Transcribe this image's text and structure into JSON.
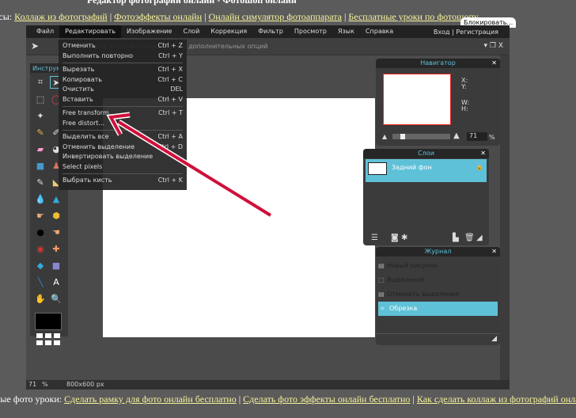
{
  "page": {
    "title": "Редактор фотографий онлайн - Фотошоп онлайн",
    "top_prefix": "исы: ",
    "top_links": [
      "Коллаж из фотографий",
      "Фотоэффекты онлайн",
      "Онлайн симулятор фотоаппарата",
      "Бесплатные уроки по фотошопу"
    ],
    "block_tab": "Блокировать...",
    "bottom_prefix": "ные фото уроки: ",
    "bottom_links": [
      "Сделать рамку для фото онлайн бесплатно",
      "Сделать фото эффекты онлайн бесплатно",
      "Как сделать коллаж из фотографий онлайн"
    ],
    "separator": " | "
  },
  "menu": {
    "items": [
      "Файл",
      "Редактировать",
      "Изображение",
      "Слой",
      "Коррекция",
      "Фильтр",
      "Просмотр",
      "Язык",
      "Справка"
    ],
    "login": "Вход",
    "sep": "|",
    "register": "Регистрация"
  },
  "options": {
    "hint": "Для этого инструмента нет дополнительных опций"
  },
  "tools": {
    "header": "Инструменты"
  },
  "edit_menu": [
    {
      "label": "Отменить",
      "shortcut": "Ctrl + Z"
    },
    {
      "label": "Выполнить повторно",
      "shortcut": "Ctrl + Y"
    },
    {
      "sep": true
    },
    {
      "label": "Вырезать",
      "shortcut": "Ctrl + X"
    },
    {
      "label": "Копировать",
      "shortcut": "Ctrl + C"
    },
    {
      "label": "Очистить",
      "shortcut": "DEL"
    },
    {
      "label": "Вставить",
      "shortcut": "Ctrl + V"
    },
    {
      "sep": true
    },
    {
      "label": "Free transform...",
      "shortcut": "Ctrl + T"
    },
    {
      "label": "Free distort...",
      "shortcut": ""
    },
    {
      "sep": true
    },
    {
      "label": "Выделить все",
      "shortcut": "Ctrl + A"
    },
    {
      "label": "Отменить выделение",
      "shortcut": "Ctrl + D"
    },
    {
      "label": "Инвертировать выделение",
      "shortcut": ""
    },
    {
      "label": "Select pixels",
      "shortcut": ""
    },
    {
      "sep": true
    },
    {
      "label": "Выбрать кисть",
      "shortcut": "Ctrl + K"
    }
  ],
  "navigator": {
    "title": "Навигатор",
    "x": "X:",
    "y": "Y:",
    "w": "W:",
    "h": "H:",
    "zoom": "71",
    "zoom_unit": "%",
    "zoom_slider": 0.15
  },
  "layers": {
    "title": "Слои",
    "items": [
      {
        "name": "Задний фон",
        "locked": true
      }
    ]
  },
  "history": {
    "title": "Журнал",
    "items": [
      {
        "label": "Новый рисунок"
      },
      {
        "label": "Выделение"
      },
      {
        "label": "Отменить выделение"
      },
      {
        "label": "Обрезка",
        "selected": true
      }
    ]
  },
  "status": {
    "zoom": "71",
    "unit": "%",
    "size": "800x600 px"
  },
  "colors": {
    "accent": "#5fc1d7",
    "link": "#f7f39b",
    "arrow": "#d0103a"
  }
}
